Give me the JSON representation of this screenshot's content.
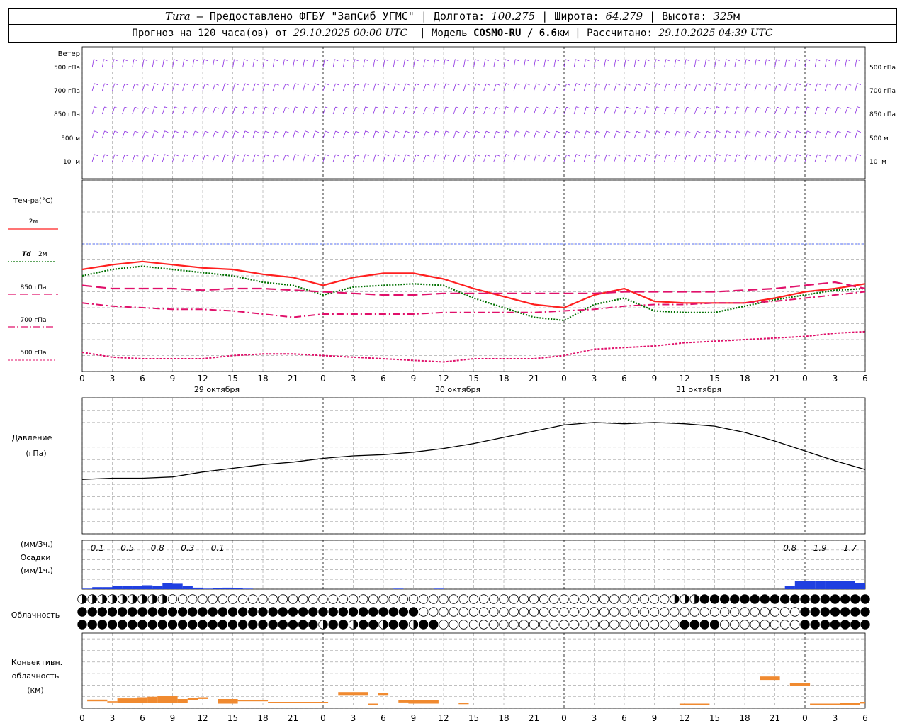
{
  "header": {
    "line1": {
      "city": "Tura",
      "dash": " – ",
      "provider": "Предоставлено ФГБУ \"ЗапСиб УГМС\"",
      "sep1": " | ",
      "lon_label": "Долгота: ",
      "lon": "100.275",
      "sep2": " | ",
      "lat_label": "Широта: ",
      "lat": "64.279",
      "sep3": " | ",
      "alt_label": "Высота: ",
      "alt": "325",
      "alt_unit": "м"
    },
    "line2": {
      "forecast_label": "Прогноз на 120 часа(ов) от ",
      "forecast_start": "29.10.2025 00:00 UTC",
      "sep1": "  | ",
      "model_label": "Модель ",
      "model": "COSMO-RU / 6.6",
      "model_unit": "км",
      "sep2": " | ",
      "calc_label": "Рассчитано: ",
      "calc_time": "29.10.2025 04:39 UTC"
    }
  },
  "panels": {
    "wind": {
      "title": "Ветер",
      "levels": [
        "500 гПа",
        "700 гПа",
        "850 гПа",
        "500 м",
        "10  м"
      ]
    },
    "temperature": {
      "title": "Тем-ра(°C)",
      "legend": [
        {
          "label": "2м",
          "color": "#ff2020",
          "style": "solid"
        },
        {
          "label_italic": "Td",
          "label": "2м",
          "color": "#007000",
          "style": "dotted"
        },
        {
          "label": "850 гПа",
          "color": "#e0106a",
          "style": "dashed"
        },
        {
          "label": "700 гПа",
          "color": "#e0106a",
          "style": "dashdot"
        },
        {
          "label": "500 гПа",
          "color": "#e0106a",
          "style": "dotted-fine"
        }
      ],
      "yticks": [
        "20",
        "15",
        "10",
        "5",
        "0",
        "-5",
        "-10",
        "-15",
        "-20",
        "-25",
        "-30",
        "-35",
        "-40"
      ]
    },
    "pressure": {
      "title": "Давление",
      "unit": "(гПа)",
      "yticks": [
        "1040",
        "1035",
        "1030",
        "1025",
        "1020",
        "1015",
        "1010",
        "1005",
        "1000",
        "995",
        "990",
        "985"
      ]
    },
    "precip": {
      "unit3": "(мм/3ч.)",
      "title": "Осадки",
      "unit1": "(мм/1ч.)",
      "yticks": [
        "5",
        "4",
        "3",
        "2",
        "1",
        "0"
      ],
      "labels": [
        "0.1",
        "0.5",
        "0.8",
        "0.3",
        "0.1",
        "0.8",
        "1.9",
        "1.7"
      ]
    },
    "cloud": {
      "title": "Облачность"
    },
    "convective": {
      "title1": "Конвективн.",
      "title2": "облачность",
      "unit": "(км)",
      "yticks": [
        "12",
        "10",
        "8",
        "6",
        "4",
        "2",
        "0"
      ]
    }
  },
  "xaxis": {
    "hour_ticks": [
      "0",
      "3",
      "6",
      "9",
      "12",
      "15",
      "18",
      "21",
      "0",
      "3",
      "6",
      "9",
      "12",
      "15",
      "18",
      "21",
      "0",
      "3",
      "6",
      "9",
      "12",
      "15",
      "18",
      "21",
      "0",
      "3",
      "6"
    ],
    "days": [
      "29 октября",
      "30 октября",
      "31 октября"
    ]
  },
  "colors": {
    "wind": "#8a2be2",
    "precip": "#1f3fe0",
    "convective": "#f08a30",
    "pressure": "#000000",
    "zero_line": "#3050ff"
  },
  "chart_data": [
    {
      "type": "line",
      "title": "Тем-ра(°C)",
      "x_unit": "hours since 29.10.2025 00:00 UTC",
      "x": [
        0,
        3,
        6,
        9,
        12,
        15,
        18,
        21,
        24,
        27,
        30,
        33,
        36,
        39,
        42,
        45,
        48,
        51,
        54,
        57,
        60,
        63,
        66,
        69,
        72,
        75,
        78
      ],
      "ylim": [
        -40,
        20
      ],
      "series": [
        {
          "name": "2м",
          "values": [
            -8,
            -6.5,
            -5.5,
            -6.5,
            -7.5,
            -8,
            -9.5,
            -10.5,
            -13,
            -10.5,
            -9.2,
            -9.2,
            -11,
            -14,
            -16.5,
            -19,
            -20,
            -16,
            -14,
            -18,
            -18.5,
            -18.5,
            -18.5,
            -17,
            -15,
            -14,
            -12.5
          ]
        },
        {
          "name": "Td 2м",
          "values": [
            -10,
            -8,
            -7,
            -8,
            -9,
            -10,
            -12,
            -13,
            -16,
            -13.5,
            -13,
            -12.5,
            -13,
            -17,
            -20,
            -23,
            -24,
            -19,
            -17,
            -21,
            -21.5,
            -21.5,
            -19.5,
            -17.5,
            -16,
            -14.5,
            -14
          ]
        },
        {
          "name": "850 гПа",
          "values": [
            -13,
            -14,
            -14,
            -14,
            -14.5,
            -14,
            -14,
            -14.5,
            -15,
            -15.5,
            -16,
            -16,
            -15.5,
            -15.5,
            -15.5,
            -15.5,
            -15.5,
            -15.5,
            -15,
            -15,
            -15,
            -15,
            -14.5,
            -14,
            -13,
            -12,
            -14
          ]
        },
        {
          "name": "700 гПа",
          "values": [
            -18.5,
            -19.5,
            -20,
            -20.5,
            -20.5,
            -21,
            -22,
            -23,
            -22,
            -22,
            -22,
            -22,
            -21.5,
            -21.5,
            -21.5,
            -21.5,
            -21,
            -20.5,
            -19.5,
            -19,
            -19,
            -18.5,
            -18.5,
            -18,
            -17,
            -16,
            -15
          ]
        },
        {
          "name": "500 гПа",
          "values": [
            -34,
            -35.5,
            -36,
            -36,
            -36,
            -35,
            -34.5,
            -34.5,
            -35,
            -35.5,
            -36,
            -36.5,
            -37,
            -36,
            -36,
            -36,
            -35,
            -33,
            -32.5,
            -32,
            -31,
            -30.5,
            -30,
            -29.5,
            -29,
            -28,
            -27.5
          ]
        }
      ]
    },
    {
      "type": "line",
      "title": "Давление",
      "x_unit": "hours since 29.10.2025 00:00 UTC",
      "ylim": [
        985,
        1040
      ],
      "x": [
        0,
        3,
        6,
        9,
        12,
        15,
        18,
        21,
        24,
        27,
        30,
        33,
        36,
        39,
        42,
        45,
        48,
        51,
        54,
        57,
        60,
        63,
        66,
        69,
        72,
        75,
        78
      ],
      "series": [
        {
          "name": "Давление",
          "values": [
            1007,
            1007.5,
            1007.5,
            1008,
            1010,
            1011.5,
            1013,
            1014,
            1015.5,
            1016.5,
            1017,
            1018,
            1019.5,
            1021.5,
            1024,
            1026.5,
            1029,
            1030,
            1029.5,
            1030,
            1029.5,
            1028.5,
            1026,
            1022.5,
            1018.5,
            1014.5,
            1011
          ]
        }
      ]
    },
    {
      "type": "bar",
      "title": "Осадки",
      "x_unit": "hours since 29.10.2025 00:00 UTC",
      "ylim": [
        0,
        5
      ],
      "x": [
        1,
        2,
        3,
        4,
        5,
        6,
        7,
        8,
        9,
        10,
        11,
        12,
        13,
        14,
        15,
        16,
        17,
        18,
        19,
        20,
        21,
        22,
        23,
        24,
        25,
        26,
        27,
        28,
        29,
        30,
        31,
        32,
        33,
        34,
        35,
        36,
        37,
        38,
        39,
        40,
        41,
        42,
        43,
        44,
        45,
        46,
        47,
        48,
        49,
        50,
        51,
        52,
        53,
        54,
        55,
        56,
        57,
        58,
        59,
        60,
        61,
        62,
        63,
        64,
        65,
        66,
        67,
        68,
        69,
        70,
        71,
        72,
        73,
        74,
        75,
        76,
        77,
        78
      ],
      "series": [
        {
          "name": "мм/1ч.",
          "values": [
            0.05,
            0.2,
            0.2,
            0.3,
            0.3,
            0.35,
            0.4,
            0.35,
            0.6,
            0.55,
            0.3,
            0.15,
            0.05,
            0.1,
            0.15,
            0.1,
            0.05,
            0,
            0,
            0,
            0,
            0,
            0,
            0,
            0,
            0,
            0,
            0,
            0,
            0,
            0,
            0.05,
            0,
            0,
            0,
            0.05,
            0,
            0,
            0,
            0,
            0,
            0,
            0,
            0,
            0,
            0,
            0,
            0,
            0,
            0,
            0,
            0,
            0,
            0,
            0,
            0,
            0,
            0,
            0,
            0,
            0,
            0,
            0,
            0,
            0,
            0,
            0,
            0,
            0,
            0,
            0.35,
            0.8,
            0.85,
            0.8,
            0.85,
            0.85,
            0.8,
            0.6
          ]
        }
      ]
    },
    {
      "type": "bar",
      "title": "Конвективн. облачность",
      "x_unit": "hours since 29.10.2025 00:00 UTC",
      "ylim": [
        0,
        13
      ],
      "segments_km": [
        {
          "x0": 0.5,
          "x1": 2.5,
          "bottom": 1.2,
          "top": 1.5
        },
        {
          "x0": 2.5,
          "x1": 3.5,
          "bottom": 1.0,
          "top": 1.2
        },
        {
          "x0": 3.5,
          "x1": 5.5,
          "bottom": 0.9,
          "top": 1.7
        },
        {
          "x0": 5.5,
          "x1": 6.5,
          "bottom": 0.9,
          "top": 1.9
        },
        {
          "x0": 6.5,
          "x1": 7.5,
          "bottom": 0.9,
          "top": 2.0
        },
        {
          "x0": 7.5,
          "x1": 9.5,
          "bottom": 0.9,
          "top": 2.2
        },
        {
          "x0": 9.5,
          "x1": 10.5,
          "bottom": 0.9,
          "top": 1.6
        },
        {
          "x0": 10.5,
          "x1": 11.5,
          "bottom": 1.4,
          "top": 1.8
        },
        {
          "x0": 11.5,
          "x1": 12.5,
          "bottom": 1.6,
          "top": 1.9
        },
        {
          "x0": 13.5,
          "x1": 15.5,
          "bottom": 0.8,
          "top": 1.6
        },
        {
          "x0": 15.5,
          "x1": 18.5,
          "bottom": 1.2,
          "top": 1.4
        },
        {
          "x0": 18.5,
          "x1": 24.5,
          "bottom": 1.0,
          "top": 1.1
        },
        {
          "x0": 25.5,
          "x1": 28.5,
          "bottom": 2.3,
          "top": 2.8
        },
        {
          "x0": 28.5,
          "x1": 29.5,
          "bottom": 0.6,
          "top": 0.8
        },
        {
          "x0": 29.5,
          "x1": 30.5,
          "bottom": 2.3,
          "top": 2.7
        },
        {
          "x0": 31.5,
          "x1": 32.5,
          "bottom": 1.0,
          "top": 1.4
        },
        {
          "x0": 32.5,
          "x1": 35.5,
          "bottom": 0.8,
          "top": 1.4
        },
        {
          "x0": 37.5,
          "x1": 38.5,
          "bottom": 0.7,
          "top": 0.9
        },
        {
          "x0": 59.5,
          "x1": 62.5,
          "bottom": 0.6,
          "top": 0.8
        },
        {
          "x0": 67.5,
          "x1": 69.5,
          "bottom": 4.9,
          "top": 5.5
        },
        {
          "x0": 70.5,
          "x1": 72.5,
          "bottom": 3.8,
          "top": 4.3
        },
        {
          "x0": 72.5,
          "x1": 75.5,
          "bottom": 0.6,
          "top": 0.8
        },
        {
          "x0": 75.5,
          "x1": 77.5,
          "bottom": 0.6,
          "top": 0.9
        },
        {
          "x0": 77.5,
          "x1": 78,
          "bottom": 0.8,
          "top": 1.1
        }
      ]
    }
  ]
}
